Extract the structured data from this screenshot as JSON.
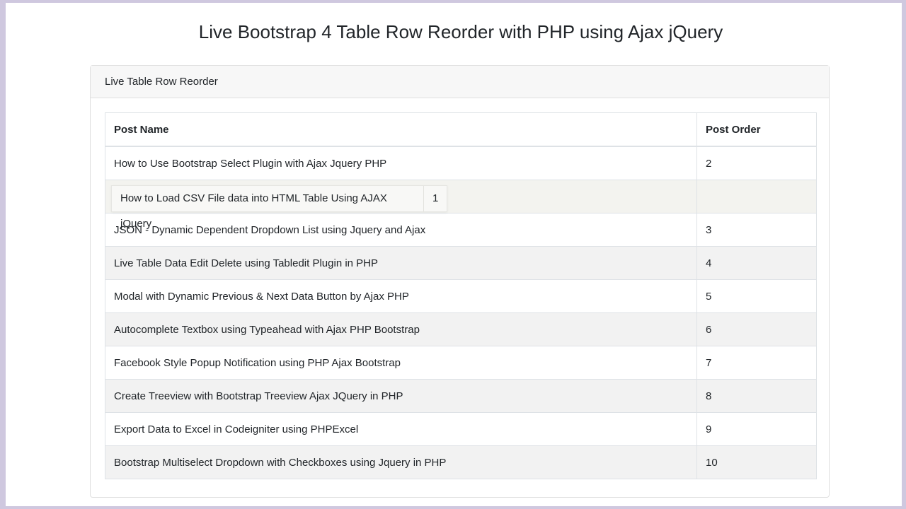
{
  "page": {
    "title": "Live Bootstrap 4 Table Row Reorder with PHP using Ajax jQuery"
  },
  "card": {
    "header": "Live Table Row Reorder"
  },
  "table": {
    "headers": [
      "Post Name",
      "Post Order"
    ],
    "rows": [
      {
        "name": "How to Use Bootstrap Select Plugin with Ajax Jquery PHP",
        "order": "2"
      },
      {
        "name": "",
        "order": ""
      },
      {
        "name": "JSON - Dynamic Dependent Dropdown List using Jquery and Ajax",
        "order": "3"
      },
      {
        "name": "Live Table Data Edit Delete using Tabledit Plugin in PHP",
        "order": "4"
      },
      {
        "name": "Modal with Dynamic Previous & Next Data Button by Ajax PHP",
        "order": "5"
      },
      {
        "name": "Autocomplete Textbox using Typeahead with Ajax PHP Bootstrap",
        "order": "6"
      },
      {
        "name": "Facebook Style Popup Notification using PHP Ajax Bootstrap",
        "order": "7"
      },
      {
        "name": "Create Treeview with Bootstrap Treeview Ajax JQuery in PHP",
        "order": "8"
      },
      {
        "name": "Export Data to Excel in Codeigniter using PHPExcel",
        "order": "9"
      },
      {
        "name": "Bootstrap Multiselect Dropdown with Checkboxes using Jquery in PHP",
        "order": "10"
      }
    ]
  },
  "dragging_row": {
    "name": "How to Load CSV File data into HTML Table Using AJAX jQuery",
    "order": "1"
  }
}
